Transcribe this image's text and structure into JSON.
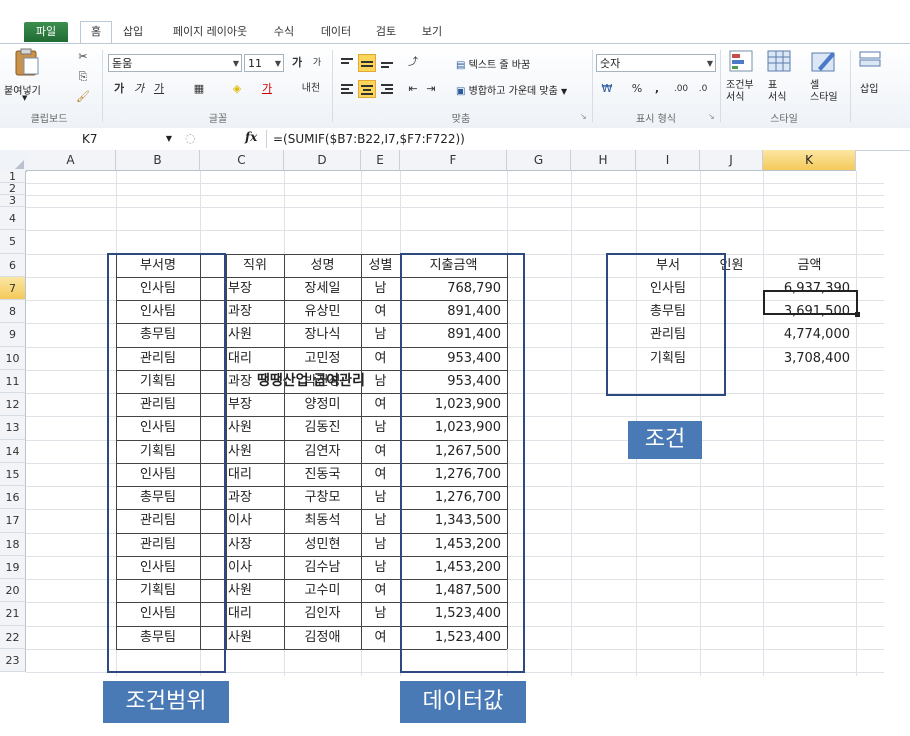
{
  "ribbon": {
    "tabs": [
      "파일",
      "홈",
      "삽입",
      "페이지 레이아웃",
      "수식",
      "데이터",
      "검토",
      "보기"
    ],
    "clipboard": {
      "paste": "붙여넣기",
      "label": "클립보드"
    },
    "font": {
      "name": "돋움",
      "size": "11",
      "bold": "가",
      "italic": "가",
      "underline": "가",
      "grow": "가",
      "shrink": "가",
      "phonetic": "내천",
      "label": "글꼴"
    },
    "align": {
      "wrap": "텍스트 줄 바꿈",
      "merge": "병합하고 가운데 맞춤",
      "label": "맞춤"
    },
    "number": {
      "format": "숫자",
      "percent": "%",
      "comma": ",",
      "inc": ".00",
      "dec": ".0",
      "label": "표시 형식"
    },
    "styles": {
      "conditional": "조건부\n서식",
      "table": "표\n서식",
      "cell": "셀\n스타일",
      "label": "스타일"
    },
    "insert": "삽입"
  },
  "formula_bar": {
    "name_box": "K7",
    "fx": "fx",
    "formula": "=(SUMIF($B7:B22,I7,$F7:F722))"
  },
  "columns": [
    "A",
    "B",
    "C",
    "D",
    "E",
    "F",
    "G",
    "H",
    "I",
    "J",
    "K"
  ],
  "rows": [
    "1",
    "2",
    "3",
    "4",
    "5",
    "6",
    "7",
    "8",
    "9",
    "10",
    "11",
    "12",
    "13",
    "14",
    "15",
    "16",
    "17",
    "18",
    "19",
    "20",
    "21",
    "22",
    "23"
  ],
  "title": "땡땡산업 급여관리",
  "table": {
    "headers": [
      "부서명",
      "직위",
      "성명",
      "성별",
      "지출금액"
    ],
    "rows": [
      [
        "인사팀",
        "부장",
        "장세일",
        "남",
        "768,790"
      ],
      [
        "인사팀",
        "과장",
        "유상민",
        "여",
        "891,400"
      ],
      [
        "총무팀",
        "사원",
        "장나식",
        "남",
        "891,400"
      ],
      [
        "관리팀",
        "대리",
        "고민정",
        "여",
        "953,400"
      ],
      [
        "기획팀",
        "과장",
        "박진성",
        "남",
        "953,400"
      ],
      [
        "관리팀",
        "부장",
        "양정미",
        "여",
        "1,023,900"
      ],
      [
        "인사팀",
        "사원",
        "김동진",
        "남",
        "1,023,900"
      ],
      [
        "기획팀",
        "사원",
        "김연자",
        "여",
        "1,267,500"
      ],
      [
        "인사팀",
        "대리",
        "진동국",
        "여",
        "1,276,700"
      ],
      [
        "총무팀",
        "과장",
        "구창모",
        "남",
        "1,276,700"
      ],
      [
        "관리팀",
        "이사",
        "최동석",
        "남",
        "1,343,500"
      ],
      [
        "관리팀",
        "사장",
        "성민현",
        "남",
        "1,453,200"
      ],
      [
        "인사팀",
        "이사",
        "김수남",
        "남",
        "1,453,200"
      ],
      [
        "기획팀",
        "사원",
        "고수미",
        "여",
        "1,487,500"
      ],
      [
        "인사팀",
        "대리",
        "김인자",
        "남",
        "1,523,400"
      ],
      [
        "총무팀",
        "사원",
        "김정애",
        "여",
        "1,523,400"
      ]
    ]
  },
  "summary": {
    "headers": [
      "부서",
      "인원",
      "금액"
    ],
    "rows": [
      [
        "인사팀",
        "",
        "6,937,390"
      ],
      [
        "총무팀",
        "",
        "3,691,500"
      ],
      [
        "관리팀",
        "",
        "4,774,000"
      ],
      [
        "기획팀",
        "",
        "3,708,400"
      ]
    ]
  },
  "callouts": {
    "criteria": "조건",
    "range": "조건범위",
    "values": "데이터값"
  },
  "colors": {
    "frame": "#2c4a80",
    "callout_bg": "#4a7ab5",
    "file_tab": "#217346",
    "highlight": "#f5c95a"
  }
}
